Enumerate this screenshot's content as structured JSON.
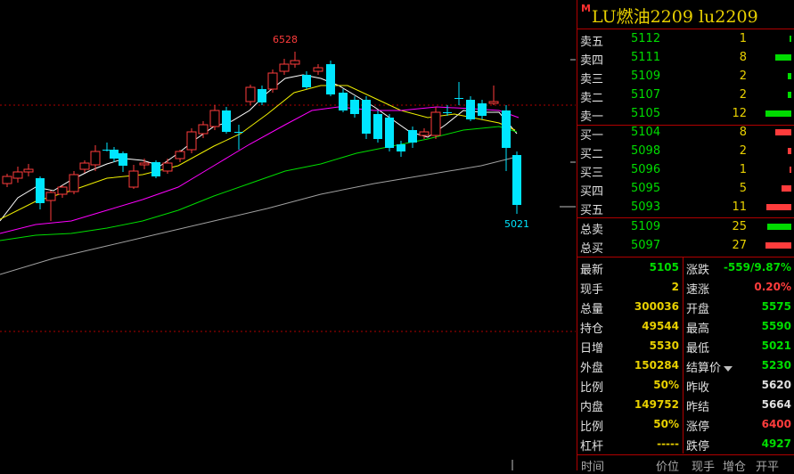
{
  "colors": {
    "up": "#ff3c3c",
    "down": "#00e6ff",
    "green": "#00dc00",
    "yellow": "#e8d000",
    "white": "#e0e0e0",
    "grid": "#b00000"
  },
  "header": {
    "marker": "M",
    "title": "LU燃油2209  lu2209"
  },
  "chart": {
    "high_label": "6528",
    "low_label": "5021",
    "ma": [
      {
        "color": "#ffffff",
        "label": ""
      },
      {
        "color": "#f0f000",
        "label": ""
      },
      {
        "color": "#ff00ff",
        "label": ""
      },
      {
        "color": "#00dd00",
        "label": ""
      },
      {
        "color": "#a0a0a0",
        "label": ""
      }
    ]
  },
  "orderbook": {
    "asks": [
      {
        "label": "卖五",
        "price": "5112",
        "vol": "1",
        "bar": 0.05
      },
      {
        "label": "卖四",
        "price": "5111",
        "vol": "8",
        "bar": 0.6
      },
      {
        "label": "卖三",
        "price": "5109",
        "vol": "2",
        "bar": 0.12
      },
      {
        "label": "卖二",
        "price": "5107",
        "vol": "2",
        "bar": 0.12
      },
      {
        "label": "卖一",
        "price": "5105",
        "vol": "12",
        "bar": 0.95
      }
    ],
    "bids": [
      {
        "label": "买一",
        "price": "5104",
        "vol": "8",
        "bar": 0.6
      },
      {
        "label": "买二",
        "price": "5098",
        "vol": "2",
        "bar": 0.12
      },
      {
        "label": "买三",
        "price": "5096",
        "vol": "1",
        "bar": 0.05
      },
      {
        "label": "买四",
        "price": "5095",
        "vol": "5",
        "bar": 0.38
      },
      {
        "label": "买五",
        "price": "5093",
        "vol": "11",
        "bar": 0.92
      }
    ],
    "totals": [
      {
        "label": "总卖",
        "price": "5109",
        "vol": "25",
        "bar": 0.9,
        "color": "#00dc00"
      },
      {
        "label": "总买",
        "price": "5097",
        "vol": "27",
        "bar": 0.98,
        "color": "#ff3c3c"
      }
    ]
  },
  "stats_left": [
    {
      "label": "最新",
      "value": "5105",
      "color": "#00dc00"
    },
    {
      "label": "现手",
      "value": "2",
      "color": "#e8d000"
    },
    {
      "label": "总量",
      "value": "300036",
      "color": "#e8d000"
    },
    {
      "label": "持仓",
      "value": "49544",
      "color": "#e8d000"
    },
    {
      "label": "日增",
      "value": "5530",
      "color": "#e8d000"
    },
    {
      "label": "外盘",
      "value": "150284",
      "color": "#e8d000"
    },
    {
      "label": "比例",
      "value": "50%",
      "color": "#e8d000"
    },
    {
      "label": "内盘",
      "value": "149752",
      "color": "#e8d000"
    },
    {
      "label": "比例",
      "value": "50%",
      "color": "#e8d000"
    },
    {
      "label": "杠杆",
      "value": "-----",
      "color": "#e8d000"
    }
  ],
  "stats_right": [
    {
      "label": "涨跌",
      "value": "-559/9.87%",
      "color": "#00dc00"
    },
    {
      "label": "速涨",
      "value": "0.20%",
      "color": "#ff3c3c"
    },
    {
      "label": "开盘",
      "value": "5575",
      "color": "#00dc00"
    },
    {
      "label": "最高",
      "value": "5590",
      "color": "#00dc00"
    },
    {
      "label": "最低",
      "value": "5021",
      "color": "#00dc00"
    },
    {
      "label": "结算价",
      "value": "5230",
      "color": "#00dc00",
      "dropdown": true
    },
    {
      "label": "昨收",
      "value": "5620",
      "color": "#e0e0e0"
    },
    {
      "label": "昨结",
      "value": "5664",
      "color": "#e0e0e0"
    },
    {
      "label": "涨停",
      "value": "6400",
      "color": "#ff3c3c"
    },
    {
      "label": "跌停",
      "value": "4927",
      "color": "#00dc00"
    }
  ],
  "footer": {
    "time": "时间",
    "price": "价位",
    "qty": "现手",
    "oi": "增仓",
    "type": "开平"
  }
}
